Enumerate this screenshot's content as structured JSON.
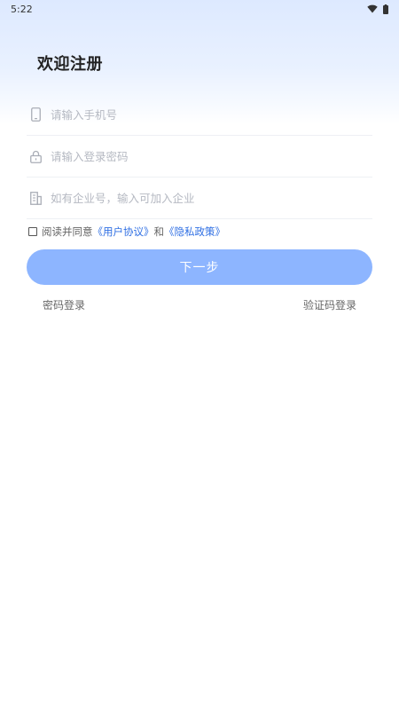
{
  "status": {
    "time": "5:22"
  },
  "page": {
    "title": "欢迎注册"
  },
  "form": {
    "phone_placeholder": "请输入手机号",
    "password_placeholder": "请输入登录密码",
    "enterprise_placeholder": "如有企业号，输入可加入企业"
  },
  "agreement": {
    "prefix": "阅读并同意",
    "user_agreement": "《用户协议》",
    "and": "和",
    "privacy_policy": "《隐私政策》"
  },
  "actions": {
    "next": "下一步",
    "password_login": "密码登录",
    "code_login": "验证码登录"
  },
  "colors": {
    "accent": "#8db5ff",
    "link": "#2f6fe3",
    "header_gradient_top": "#dde9ff"
  },
  "icons": {
    "phone": "phone-icon",
    "lock": "lock-icon",
    "building": "building-icon"
  }
}
